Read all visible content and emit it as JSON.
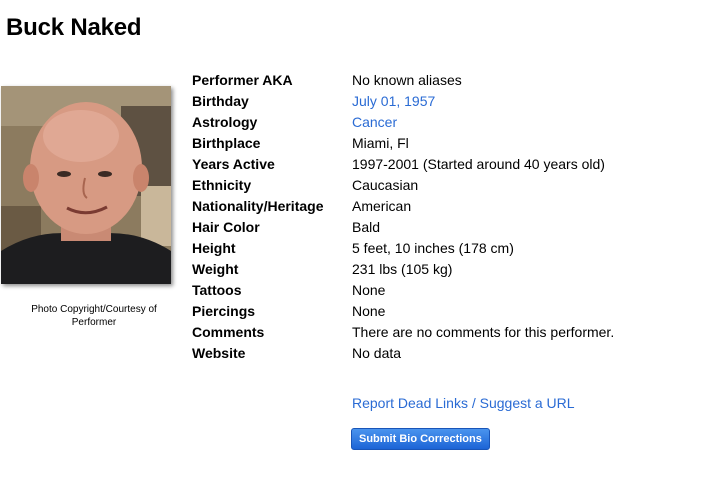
{
  "performer": {
    "name": "Buck Naked"
  },
  "photo": {
    "caption": "Photo Copyright/Courtesy of Performer"
  },
  "bio": [
    {
      "label": "Performer AKA",
      "value": "No known aliases",
      "is_link": false
    },
    {
      "label": "Birthday",
      "value": "July 01, 1957",
      "is_link": true
    },
    {
      "label": "Astrology",
      "value": "Cancer",
      "is_link": true
    },
    {
      "label": "Birthplace",
      "value": "Miami, Fl",
      "is_link": false
    },
    {
      "label": "Years Active",
      "value": "1997-2001 (Started around 40 years old)",
      "is_link": false
    },
    {
      "label": "Ethnicity",
      "value": "Caucasian",
      "is_link": false
    },
    {
      "label": "Nationality/Heritage",
      "value": "American",
      "is_link": false
    },
    {
      "label": "Hair Color",
      "value": "Bald",
      "is_link": false
    },
    {
      "label": "Height",
      "value": "5 feet, 10 inches (178 cm)",
      "is_link": false
    },
    {
      "label": "Weight",
      "value": "231 lbs (105 kg)",
      "is_link": false
    },
    {
      "label": "Tattoos",
      "value": "None",
      "is_link": false
    },
    {
      "label": "Piercings",
      "value": "None",
      "is_link": false
    },
    {
      "label": "Comments",
      "value": "There are no comments for this performer.",
      "is_link": false
    },
    {
      "label": "Website",
      "value": "No data",
      "is_link": false
    }
  ],
  "actions": {
    "report_link": "Report Dead Links / Suggest a URL",
    "submit_button": "Submit Bio Corrections"
  },
  "colors": {
    "link": "#2a6bd4",
    "button": "#1c64d6"
  }
}
